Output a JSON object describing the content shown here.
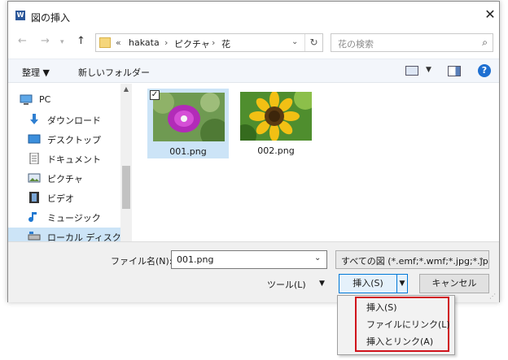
{
  "window": {
    "title": "図の挿入",
    "app_icon_letter": "W"
  },
  "address_bar": {
    "overflow": "«",
    "crumbs": [
      "hakata",
      "ピクチャ",
      "花"
    ]
  },
  "search": {
    "placeholder": "花の検索"
  },
  "toolbar": {
    "organize": "整理 ▼",
    "new_folder": "新しいフォルダー"
  },
  "nav_pane": {
    "items": [
      {
        "label": "PC",
        "icon": "computer-icon"
      },
      {
        "label": "ダウンロード",
        "icon": "download-arrow-icon"
      },
      {
        "label": "デスクトップ",
        "icon": "desktop-icon"
      },
      {
        "label": "ドキュメント",
        "icon": "document-icon"
      },
      {
        "label": "ピクチャ",
        "icon": "pictures-icon"
      },
      {
        "label": "ビデオ",
        "icon": "video-icon"
      },
      {
        "label": "ミュージック",
        "icon": "music-note-icon"
      },
      {
        "label": "ローカル ディスク (C",
        "icon": "disk-icon"
      }
    ]
  },
  "files": [
    {
      "name": "001.png",
      "selected": true
    },
    {
      "name": "002.png",
      "selected": false
    }
  ],
  "bottom": {
    "filename_label": "ファイル名(N):",
    "filename_value": "001.png",
    "filetype_value": "すべての図 (*.emf;*.wmf;*.jpg;*.jp",
    "tools_label": "ツール(L)",
    "insert_label": "挿入(S)",
    "cancel_label": "キャンセル"
  },
  "insert_menu": {
    "items": [
      "挿入(S)",
      "ファイルにリンク(L)",
      "挿入とリンク(A)"
    ]
  },
  "colors": {
    "accent": "#0078d7",
    "highlight_border": "#d0121b",
    "selection": "#cce4f7"
  }
}
